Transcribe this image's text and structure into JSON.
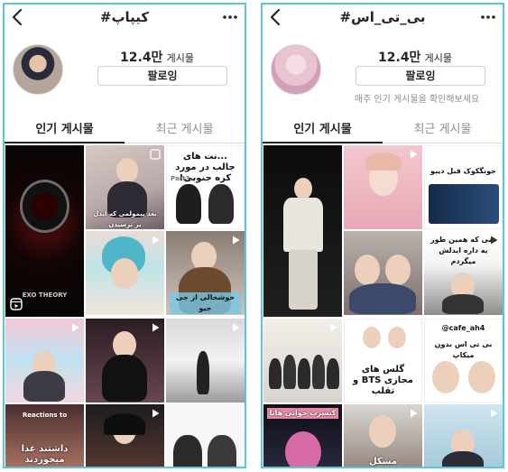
{
  "left_panel": {
    "hashtag": "#کیپاپ",
    "post_count": "12.4만",
    "post_count_label": "게시물",
    "follow_label": "팔로잉",
    "tabs": [
      "인기 게시물",
      "최근 게시물"
    ],
    "captions": {
      "c1": "EXO THEORY",
      "c2": "بعد پيمولمي كه ايدل بر ترسيدن",
      "c3": "...نت های جالب در مورد کره جنوبی!",
      "c4": "Part3",
      "c5": "خوشحالی از جی جیو",
      "c6": "Reactions to",
      "c7": "داشتند غذا میخوردند"
    }
  },
  "right_panel": {
    "hashtag": "#بی_تی_اس",
    "post_count": "12.4만",
    "post_count_label": "게시물",
    "follow_label": "팔로잉",
    "sub_text": "매주 인기 게시물을 확인해보세요",
    "tabs": [
      "인기 게시물",
      "최근 게시물"
    ],
    "captions": {
      "c1": "جونگکوک قبل ديبو",
      "c2": "منی که همین طور یه داره ایدلش میگردم",
      "c3": "گلس های مجازی BTS و تقلب",
      "c4": "@cafe_ah4",
      "c5": "بی تی اس بدون میکاپ",
      "c6": "مشکل",
      "c7": "کنسرت جوانی هانا"
    }
  },
  "colors": {
    "frame": "#59c7d6",
    "text": "#262626",
    "muted": "#8e8e8e"
  }
}
